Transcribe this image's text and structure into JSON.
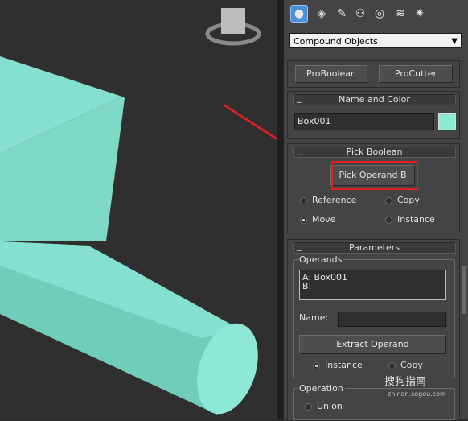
{
  "command_panel": {
    "tabs": [
      {
        "icon": "sphere-icon",
        "active": true
      },
      {
        "icon": "shapes-icon"
      },
      {
        "icon": "lights-icon"
      },
      {
        "icon": "camera-icon"
      },
      {
        "icon": "helpers-icon"
      },
      {
        "icon": "spacewarps-icon"
      },
      {
        "icon": "systems-icon"
      }
    ],
    "category_dropdown": {
      "selected": "Compound Objects"
    },
    "object_type": {
      "buttons": [
        "ProBoolean",
        "ProCutter"
      ]
    },
    "name_and_color": {
      "title": "Name and Color",
      "name_value": "Box001",
      "color": "#8ee8d6"
    },
    "pick_boolean": {
      "title": "Pick Boolean",
      "pick_button": "Pick Operand B",
      "options": [
        {
          "label": "Reference",
          "checked": false
        },
        {
          "label": "Copy",
          "checked": false
        },
        {
          "label": "Move",
          "checked": true
        },
        {
          "label": "Instance",
          "checked": false
        }
      ]
    },
    "parameters": {
      "title": "Parameters",
      "operands_group": "Operands",
      "operands_list": [
        "A: Box001",
        "B:"
      ],
      "name_label": "Name:",
      "name_value": "",
      "extract_button": "Extract Operand",
      "extract_options": [
        {
          "label": "Instance",
          "checked": true
        },
        {
          "label": "Copy",
          "checked": false
        }
      ],
      "operation_group": "Operation",
      "operation_options": [
        {
          "label": "Union",
          "checked": false
        }
      ]
    }
  },
  "viewport": {
    "object_color": "#86e0cf",
    "background": "#2f2f2f"
  },
  "watermark": {
    "brand": "搜狗指南",
    "url": "zhinan.sogou.com"
  },
  "annotation": {
    "color": "#e02020"
  }
}
